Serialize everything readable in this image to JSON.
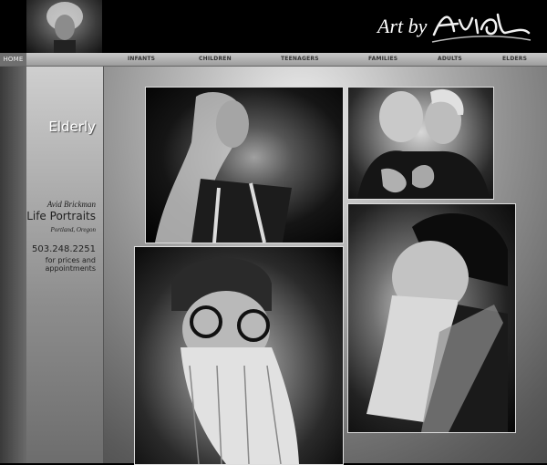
{
  "header": {
    "logo_prefix": "Art by",
    "logo_name": "Avid"
  },
  "nav": {
    "home": "HOME",
    "items": [
      "INFANTS",
      "CHILDREN",
      "TEENAGERS",
      "FAMILIES",
      "ADULTS",
      "ELDERS"
    ]
  },
  "section_title": "Elderly",
  "contact": {
    "name": "Avid Brickman",
    "service": "Life Portraits",
    "city": "Portland, Oregon",
    "phone": "503.248.2251",
    "note_line1": "for prices and",
    "note_line2": "appointments"
  },
  "photos": [
    {
      "name": "portrait-long-haired-man"
    },
    {
      "name": "portrait-elderly-couple"
    },
    {
      "name": "portrait-bearded-man-glasses"
    },
    {
      "name": "portrait-bearded-man-profile"
    }
  ]
}
